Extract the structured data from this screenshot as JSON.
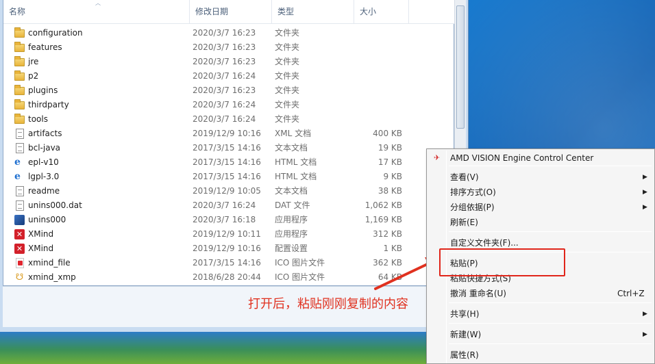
{
  "columns": {
    "name": "名称",
    "date": "修改日期",
    "type": "类型",
    "size": "大小"
  },
  "files": [
    {
      "icon": "folder-icon",
      "name": "configuration",
      "date": "2020/3/7 16:23",
      "type": "文件夹",
      "size": ""
    },
    {
      "icon": "folder-icon",
      "name": "features",
      "date": "2020/3/7 16:23",
      "type": "文件夹",
      "size": ""
    },
    {
      "icon": "folder-icon",
      "name": "jre",
      "date": "2020/3/7 16:23",
      "type": "文件夹",
      "size": ""
    },
    {
      "icon": "folder-icon",
      "name": "p2",
      "date": "2020/3/7 16:24",
      "type": "文件夹",
      "size": ""
    },
    {
      "icon": "folder-icon",
      "name": "plugins",
      "date": "2020/3/7 16:23",
      "type": "文件夹",
      "size": ""
    },
    {
      "icon": "folder-icon",
      "name": "thirdparty",
      "date": "2020/3/7 16:24",
      "type": "文件夹",
      "size": ""
    },
    {
      "icon": "folder-icon",
      "name": "tools",
      "date": "2020/3/7 16:24",
      "type": "文件夹",
      "size": ""
    },
    {
      "icon": "xml-document-icon",
      "name": "artifacts",
      "date": "2019/12/9 10:16",
      "type": "XML 文档",
      "size": "400 KB"
    },
    {
      "icon": "text-document-icon",
      "name": "bcl-java",
      "date": "2017/3/15 14:16",
      "type": "文本文档",
      "size": "19 KB"
    },
    {
      "icon": "html-document-icon",
      "name": "epl-v10",
      "date": "2017/3/15 14:16",
      "type": "HTML 文档",
      "size": "17 KB"
    },
    {
      "icon": "html-document-icon",
      "name": "lgpl-3.0",
      "date": "2017/3/15 14:16",
      "type": "HTML 文档",
      "size": "9 KB"
    },
    {
      "icon": "text-document-icon",
      "name": "readme",
      "date": "2019/12/9 10:05",
      "type": "文本文档",
      "size": "38 KB"
    },
    {
      "icon": "dat-file-icon",
      "name": "unins000.dat",
      "date": "2020/3/7 16:24",
      "type": "DAT 文件",
      "size": "1,062 KB"
    },
    {
      "icon": "uninstaller-icon",
      "name": "unins000",
      "date": "2020/3/7 16:18",
      "type": "应用程序",
      "size": "1,169 KB"
    },
    {
      "icon": "xmind-app-icon",
      "name": "XMind",
      "date": "2019/12/9 10:11",
      "type": "应用程序",
      "size": "312 KB"
    },
    {
      "icon": "xmind-config-icon",
      "name": "XMind",
      "date": "2019/12/9 10:16",
      "type": "配置设置",
      "size": "1 KB"
    },
    {
      "icon": "xmind-file-icon",
      "name": "xmind_file",
      "date": "2017/3/15 14:16",
      "type": "ICO 图片文件",
      "size": "362 KB"
    },
    {
      "icon": "xmind-xmp-icon",
      "name": "xmind_xmp",
      "date": "2018/6/28 20:44",
      "type": "ICO 图片文件",
      "size": "64 KB"
    }
  ],
  "annotation": "打开后，粘贴刚刚复制的内容",
  "context_menu": {
    "items": [
      {
        "label": "AMD VISION Engine Control Center",
        "icon": "amd-icon",
        "submenu": false,
        "shortcut": ""
      },
      {
        "label": "查看(V)",
        "submenu": true,
        "shortcut": ""
      },
      {
        "label": "排序方式(O)",
        "submenu": true,
        "shortcut": ""
      },
      {
        "label": "分组依据(P)",
        "submenu": true,
        "shortcut": ""
      },
      {
        "label": "刷新(E)",
        "submenu": false,
        "shortcut": ""
      },
      {
        "label": "自定义文件夹(F)...",
        "submenu": false,
        "shortcut": ""
      },
      {
        "label": "粘贴(P)",
        "submenu": false,
        "shortcut": ""
      },
      {
        "label": "粘贴快捷方式(S)",
        "submenu": false,
        "shortcut": ""
      },
      {
        "label": "撤消 重命名(U)",
        "submenu": false,
        "shortcut": "Ctrl+Z"
      },
      {
        "label": "共享(H)",
        "submenu": true,
        "shortcut": ""
      },
      {
        "label": "新建(W)",
        "submenu": true,
        "shortcut": ""
      },
      {
        "label": "属性(R)",
        "submenu": false,
        "shortcut": ""
      }
    ]
  },
  "colors": {
    "annotation": "#e0311f",
    "highlight_box": "#e0251a"
  }
}
